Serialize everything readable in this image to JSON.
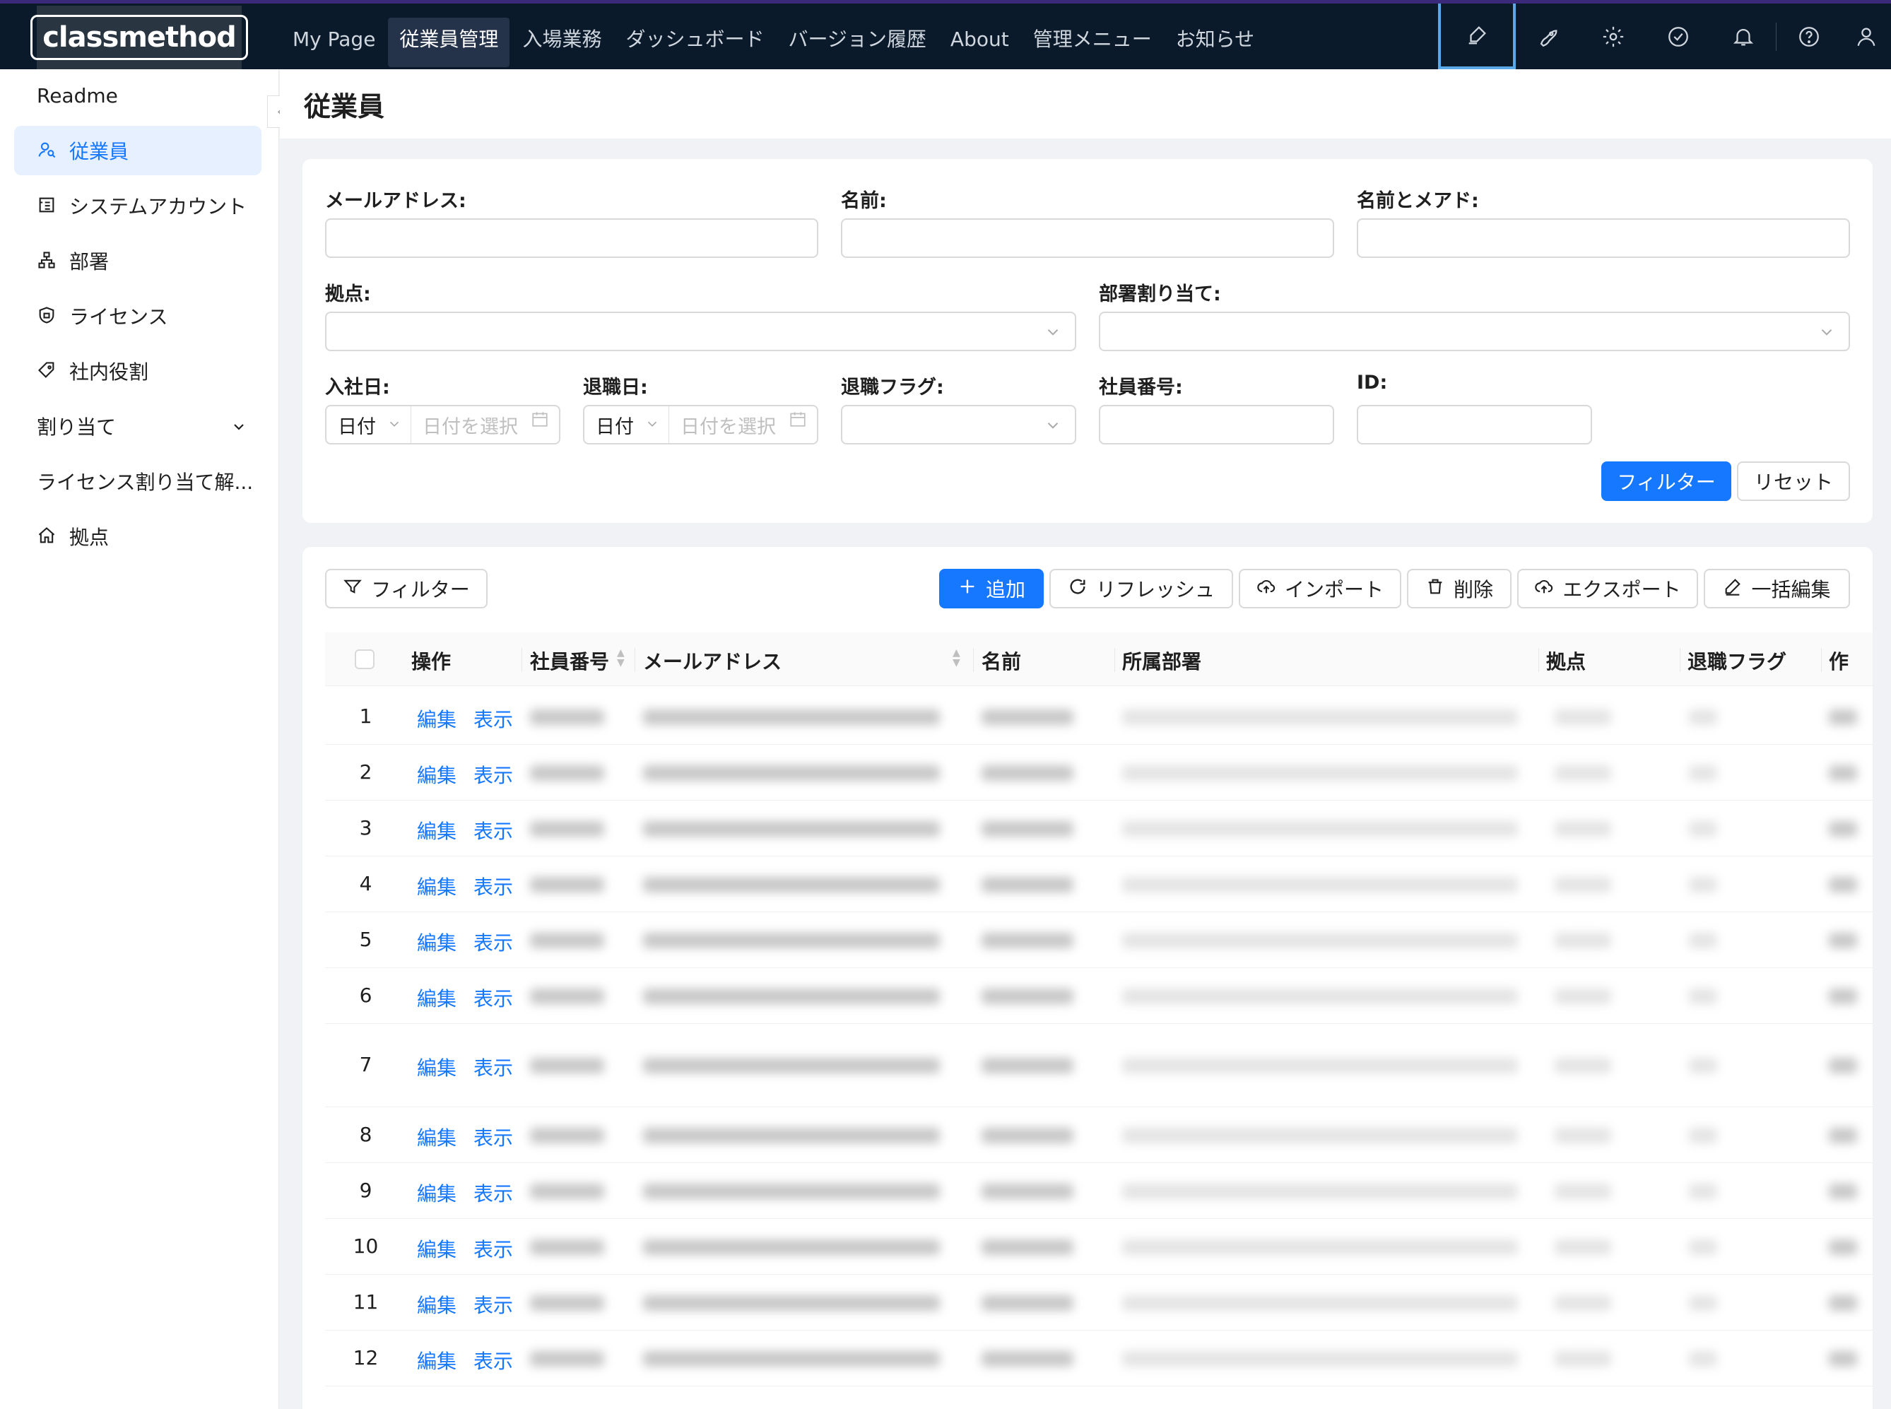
{
  "header": {
    "logo_text": "classmethod",
    "nav": [
      "My Page",
      "従業員管理",
      "入場業務",
      "ダッシュボード",
      "バージョン履歴",
      "About",
      "管理メニュー",
      "お知らせ"
    ],
    "active_nav": 1,
    "icons": [
      "highlighter-icon",
      "rocket-icon",
      "gear-icon",
      "check-circle-icon",
      "bell-icon",
      "help-icon",
      "user-icon"
    ]
  },
  "sidebar": {
    "items": [
      {
        "label": "Readme",
        "icon": ""
      },
      {
        "label": "従業員",
        "icon": "user-search-icon",
        "active": true
      },
      {
        "label": "システムアカウント",
        "icon": "account-box-icon"
      },
      {
        "label": "部署",
        "icon": "org-chart-icon"
      },
      {
        "label": "ライセンス",
        "icon": "shield-icon"
      },
      {
        "label": "社内役割",
        "icon": "tag-icon"
      },
      {
        "label": "割り当て",
        "icon": "",
        "expandable": true
      },
      {
        "label": "ライセンス割り当て解...",
        "icon": ""
      },
      {
        "label": "拠点",
        "icon": "home-icon"
      }
    ]
  },
  "page": {
    "title": "従業員"
  },
  "filters": {
    "email_label": "メールアドレス:",
    "name_label": "名前:",
    "name_email_label": "名前とメアド:",
    "site_label": "拠点:",
    "dept_label": "部署割り当て:",
    "join_label": "入社日:",
    "leave_label": "退職日:",
    "retire_flag_label": "退職フラグ:",
    "emp_no_label": "社員番号:",
    "id_label": "ID:",
    "date_mode": "日付",
    "date_placeholder": "日付を選択",
    "filter_button": "フィルター",
    "reset_button": "リセット"
  },
  "toolbar": {
    "filter": "フィルター",
    "add": "追加",
    "refresh": "リフレッシュ",
    "import": "インポート",
    "delete": "削除",
    "export": "エクスポート",
    "bulk_edit": "一括編集"
  },
  "table": {
    "columns": [
      "操作",
      "社員番号",
      "メールアドレス",
      "名前",
      "所属部署",
      "拠点",
      "退職フラグ",
      "作"
    ],
    "edit_label": "編集",
    "view_label": "表示",
    "rows": [
      "1",
      "2",
      "3",
      "4",
      "5",
      "6",
      "7",
      "8",
      "9",
      "10",
      "11",
      "12"
    ]
  }
}
